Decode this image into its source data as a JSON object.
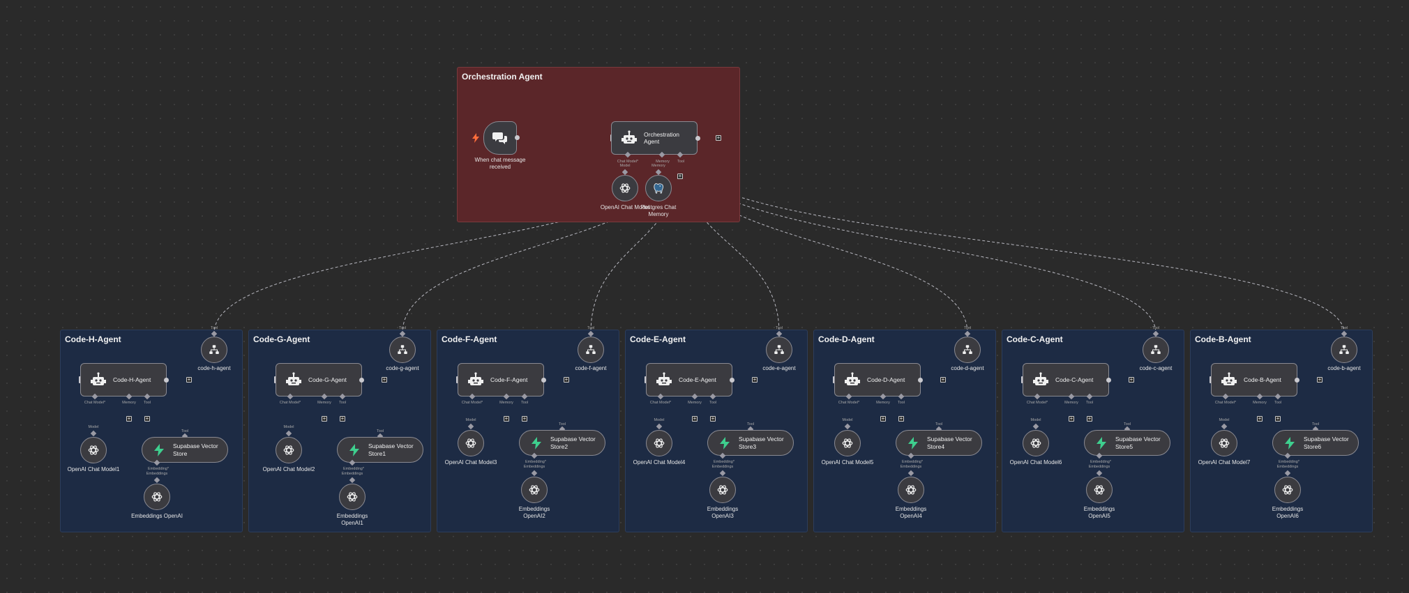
{
  "orchestration": {
    "title": "Orchestration Agent",
    "trigger_label": "When chat message received",
    "agent_label": "Orchestration Agent",
    "model_label": "OpenAI Chat Model",
    "memory_label": "Postgres Chat Memory",
    "ports": {
      "chat_model": "Chat Model*",
      "memory": "Memory",
      "tool": "Tool",
      "model": "Model"
    }
  },
  "port_labels": {
    "chat_model": "Chat Model*",
    "memory": "Memory",
    "tool": "Tool",
    "model": "Model",
    "embedding": "Embedding*",
    "embeddings": "Embeddings"
  },
  "colors": {
    "canvas": "#2a2a2a",
    "orchestration_sticky": "#5b2629",
    "agent_sticky": "#1d2b44",
    "node_fill": "#3b3b40",
    "node_border": "#8a8a92",
    "supabase_green": "#3ecf8e",
    "trigger_orange": "#ff6d3b"
  },
  "agents": [
    {
      "title": "Code-H-Agent",
      "tool_label": "code-h-agent",
      "agent_label": "Code-H-Agent",
      "model_label": "OpenAI Chat Model1",
      "vector_label": "Supabase Vector Store",
      "embed_label": "Embeddings OpenAI"
    },
    {
      "title": "Code-G-Agent",
      "tool_label": "code-g-agent",
      "agent_label": "Code-G-Agent",
      "model_label": "OpenAI Chat Model2",
      "vector_label": "Supabase Vector Store1",
      "embed_label": "Embeddings OpenAI1"
    },
    {
      "title": "Code-F-Agent",
      "tool_label": "code-f-agent",
      "agent_label": "Code-F-Agent",
      "model_label": "OpenAI Chat Model3",
      "vector_label": "Supabase Vector Store2",
      "embed_label": "Embeddings OpenAI2"
    },
    {
      "title": "Code-E-Agent",
      "tool_label": "code-e-agent",
      "agent_label": "Code-E-Agent",
      "model_label": "OpenAI Chat Model4",
      "vector_label": "Supabase Vector Store3",
      "embed_label": "Embeddings OpenAI3"
    },
    {
      "title": "Code-D-Agent",
      "tool_label": "code-d-agent",
      "agent_label": "Code-D-Agent",
      "model_label": "OpenAI Chat Model5",
      "vector_label": "Supabase Vector Store4",
      "embed_label": "Embeddings OpenAI4"
    },
    {
      "title": "Code-C-Agent",
      "tool_label": "code-c-agent",
      "agent_label": "Code-C-Agent",
      "model_label": "OpenAI Chat Model6",
      "vector_label": "Supabase Vector Store5",
      "embed_label": "Embeddings OpenAI5"
    },
    {
      "title": "Code-B-Agent",
      "tool_label": "code-b-agent",
      "agent_label": "Code-B-Agent",
      "model_label": "OpenAI Chat Model7",
      "vector_label": "Supabase Vector Store6",
      "embed_label": "Embeddings OpenAI6"
    }
  ]
}
